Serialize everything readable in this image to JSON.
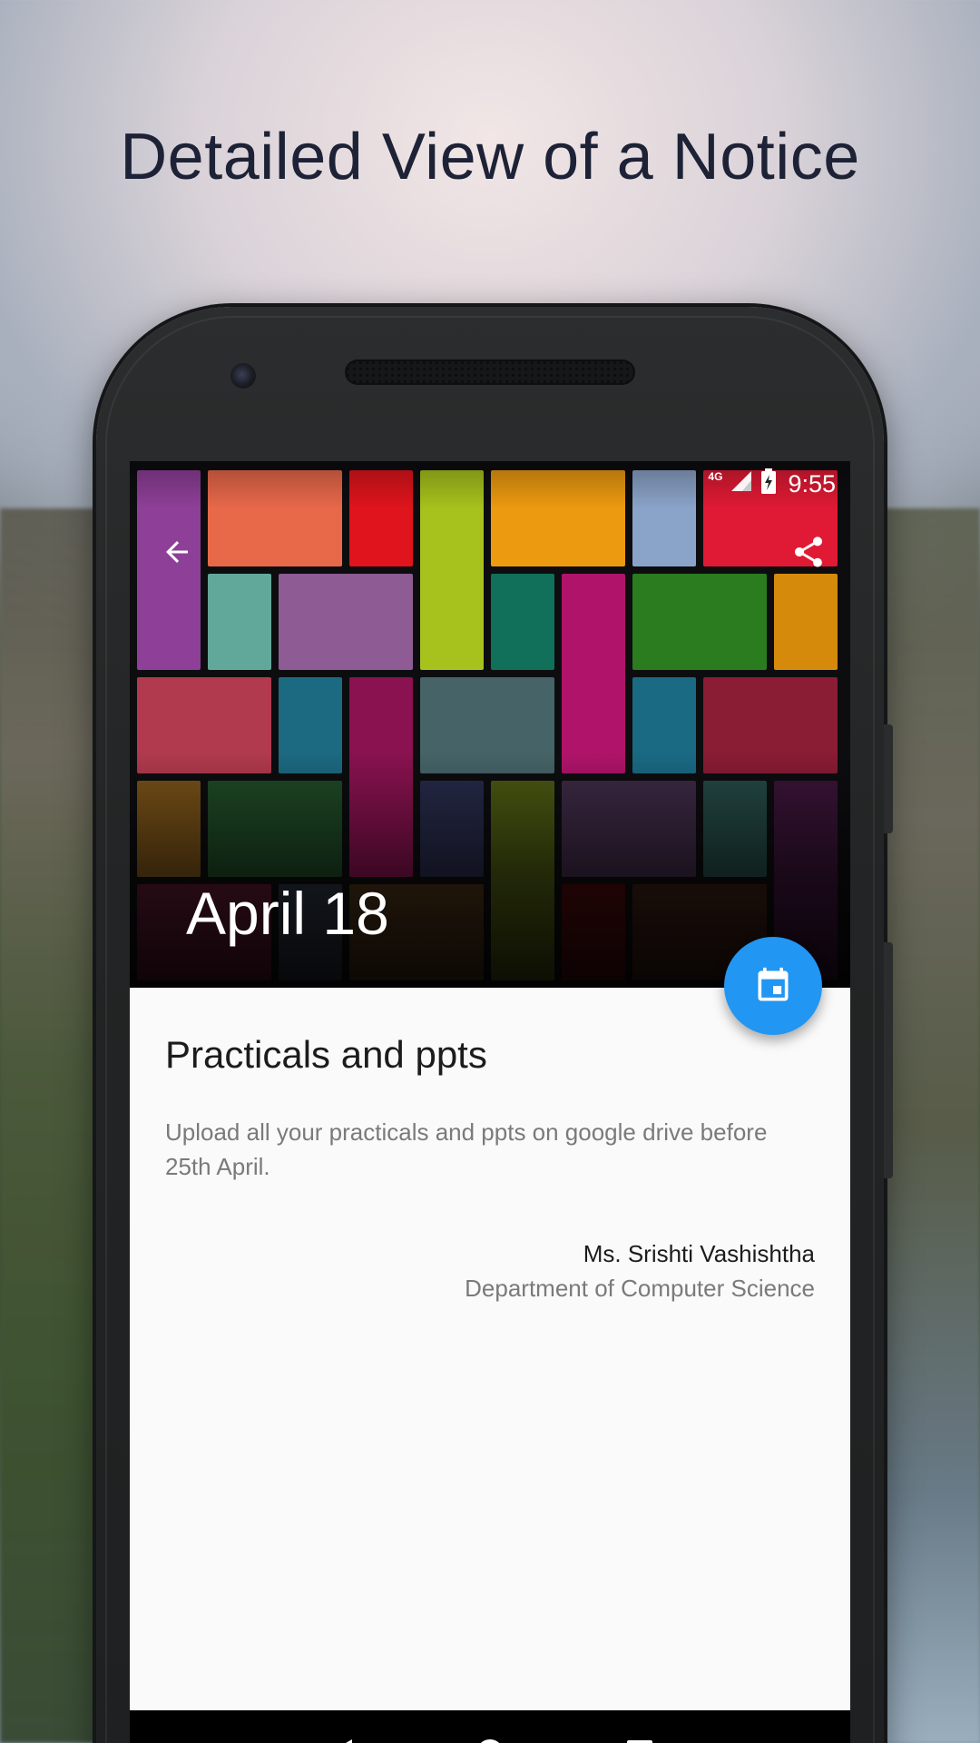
{
  "headline": "Detailed View of a Notice",
  "status_bar": {
    "network": "4G",
    "time": "9:55"
  },
  "toolbar": {
    "back_icon": "arrow-back-icon",
    "share_icon": "share-icon"
  },
  "hero": {
    "date": "April 18"
  },
  "fab": {
    "icon": "calendar-icon",
    "color": "#2196f3"
  },
  "notice": {
    "title": "Practicals and ppts",
    "body": "Upload all your practicals and ppts on google drive before 25th April.",
    "sender_name": "Ms. Srishti Vashishtha",
    "sender_department": "Department of Computer Science"
  },
  "nav": {
    "back_icon": "nav-back-icon",
    "home_icon": "nav-home-icon",
    "recents_icon": "nav-recents-icon"
  }
}
